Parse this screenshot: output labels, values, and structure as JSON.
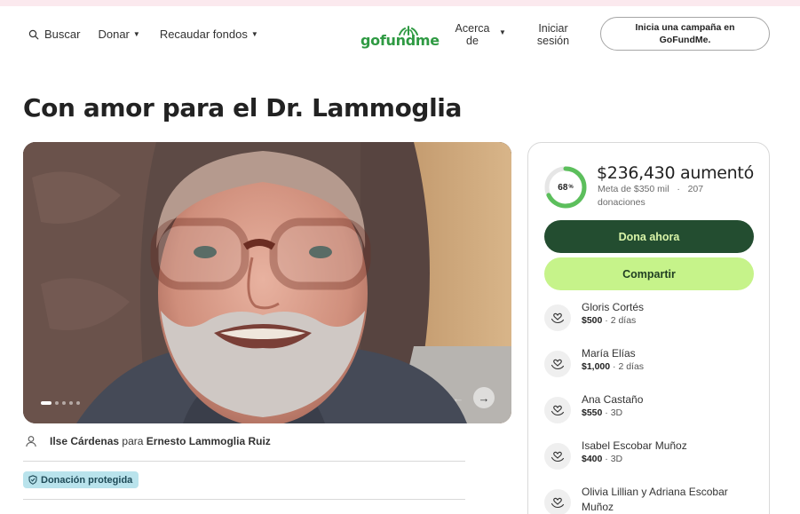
{
  "header": {
    "search_label": "Buscar",
    "donate_label": "Donar",
    "fundraise_label": "Recaudar fondos",
    "logo_text": "gofundme",
    "about_label": "Acerca de",
    "login_label": "Iniciar sesión",
    "cta_label": "Inicia una campaña en GoFundMe."
  },
  "campaign": {
    "title": "Con amor para el Dr. Lammoglia",
    "organizer": "Ilse Cárdenas",
    "organizer_for": "para",
    "beneficiary": "Ernesto Lammoglia Ruiz",
    "protected_badge": "Donación protegida",
    "photo_slides": 5,
    "active_slide": 1
  },
  "progress": {
    "percent": 68,
    "percent_label": "68",
    "percent_sign": "%",
    "raised": "$236,430 aumentó",
    "goal_text": "Meta de $350 mil",
    "separator": "·",
    "donations_text": "207 donaciones"
  },
  "actions": {
    "donate_label": "Dona ahora",
    "share_label": "Compartir"
  },
  "donors": [
    {
      "name": "Gloris Cortés",
      "amount": "$500",
      "time": "· 2 días"
    },
    {
      "name": "María Elías",
      "amount": "$1,000",
      "time": "· 2 días"
    },
    {
      "name": "Ana Castaño",
      "amount": "$550",
      "time": "· 3D"
    },
    {
      "name": "Isabel Escobar Muñoz",
      "amount": "$400",
      "time": "· 3D"
    },
    {
      "name": "Olivia Lillian y Adriana Escobar Muñoz",
      "amount": "",
      "time": ""
    }
  ],
  "colors": {
    "brand_green": "#2f9a43",
    "donate_bg": "#234d30",
    "share_bg": "#c6f38a",
    "ring_fill": "#5cbf5c",
    "badge_bg": "#b9e3ec"
  }
}
